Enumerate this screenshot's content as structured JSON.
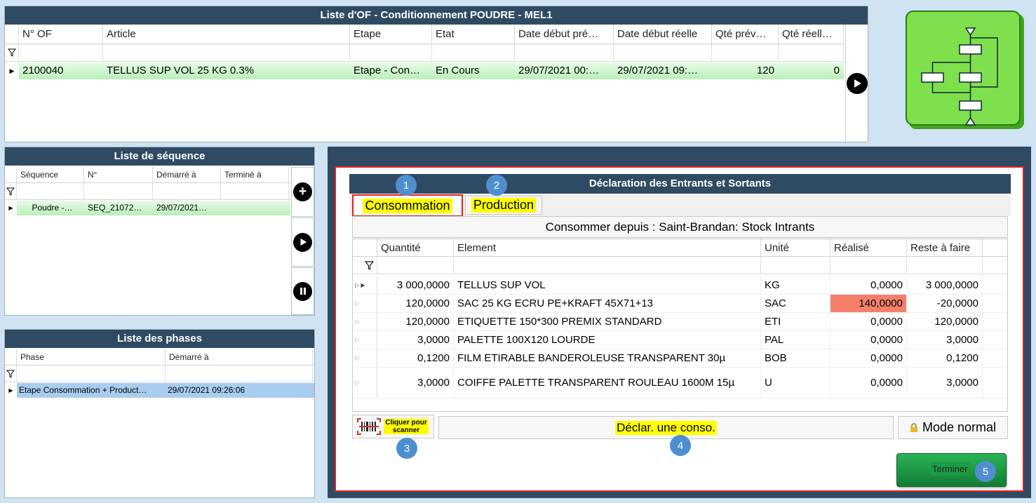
{
  "of_panel": {
    "title": "Liste d'OF - Conditionnement POUDRE - MEL1",
    "columns": [
      "N° OF",
      "Article",
      "Etape",
      "Etat",
      "Date début pré…",
      "Date début réelle",
      "Qté  prév…",
      "Qté  réell…"
    ],
    "row": [
      "2100040",
      "TELLUS SUP VOL 25 KG 0.3%",
      "Etape - Con…",
      "En Cours",
      "29/07/2021  00:…",
      "29/07/2021  09:…",
      "120",
      "0"
    ]
  },
  "sequence_panel": {
    "title": "Liste de séquence",
    "columns": [
      "Séquence",
      "N°",
      "Démarré à",
      "Terminé à"
    ],
    "row": [
      "Poudre -…",
      "SEQ_21072…",
      "29/07/2021…",
      ""
    ]
  },
  "phases_panel": {
    "title": "Liste des phases",
    "columns": [
      "Phase",
      "Démarré à"
    ],
    "row": [
      "Etape Consommation + Product…",
      "29/07/2021 09:26:06"
    ]
  },
  "decl_panel": {
    "title": "Déclaration des Entrants et Sortants",
    "tabs": [
      "Consommation",
      "Production"
    ],
    "consume_from": "Consommer depuis : Saint-Brandan: Stock Intrants",
    "columns": [
      "Quantité",
      "Element",
      "Unité",
      "Réalisé",
      "Reste à faire"
    ],
    "rows": [
      {
        "qty": "3 000,0000",
        "element": "TELLUS SUP VOL",
        "unit": "KG",
        "done": "0,0000",
        "remaining": "3 000,0000"
      },
      {
        "qty": "120,0000",
        "element": "SAC 25 KG ECRU PE+KRAFT 45X71+13",
        "unit": "SAC",
        "done": "140,0000",
        "remaining": "-20,0000"
      },
      {
        "qty": "120,0000",
        "element": "ETIQUETTE 150*300 PREMIX STANDARD",
        "unit": "ETI",
        "done": "0,0000",
        "remaining": "120,0000"
      },
      {
        "qty": "3,0000",
        "element": "PALETTE 100X120 LOURDE",
        "unit": "PAL",
        "done": "0,0000",
        "remaining": "3,0000"
      },
      {
        "qty": "0,1200",
        "element": "FILM ETIRABLE BANDEROLEUSE TRANSPARENT 30µ",
        "unit": "BOB",
        "done": "0,0000",
        "remaining": "0,1200"
      },
      {
        "qty": "3,0000",
        "element": "COIFFE PALETTE TRANSPARENT ROULEAU 1600M 15µ",
        "unit": "U",
        "done": "0,0000",
        "remaining": "3,0000"
      }
    ],
    "scan_label": "Cliquer pour scanner",
    "decl_label": "Déclar. une conso.",
    "mode_label": "Mode normal",
    "finish_label": "Terminer"
  },
  "badges": [
    "1",
    "2",
    "3",
    "4",
    "5"
  ],
  "colors": {
    "title_bg": "#2f4b63",
    "green_row": "#b9efb9",
    "overflow_cell": "#f4806c",
    "highlight": "#ffff00",
    "finish_button": "#1f9e45"
  },
  "icons": {
    "filter": "funnel-icon",
    "play": "play-icon",
    "add": "plus-icon",
    "pause": "pause-icon",
    "barcode": "barcode-icon",
    "lock": "lock-icon",
    "workflow": "workflow-diagram-icon"
  }
}
